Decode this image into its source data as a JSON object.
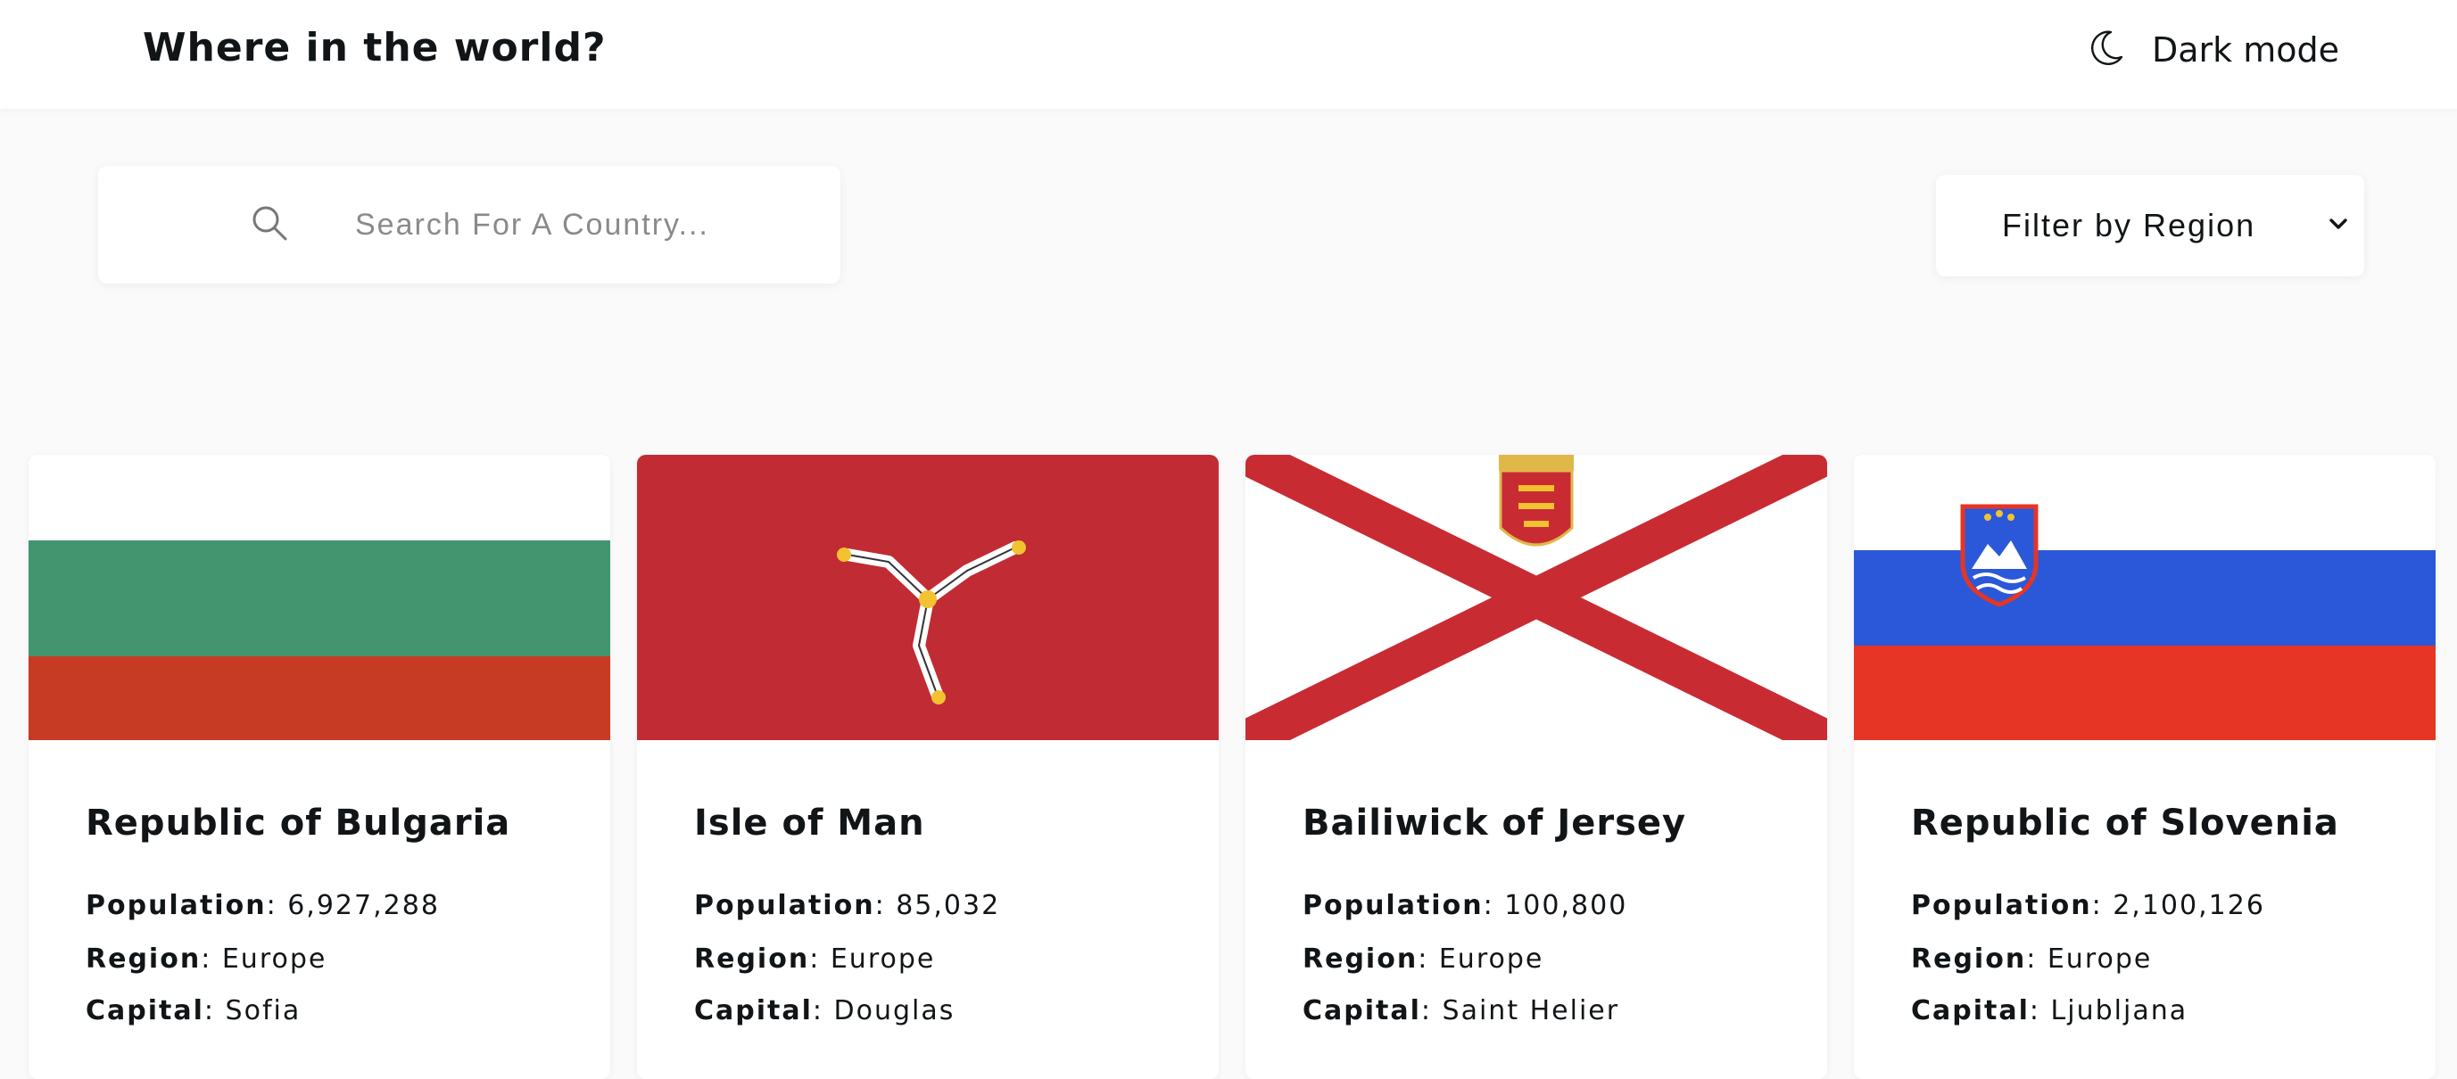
{
  "header": {
    "title": "Where in the world?",
    "theme_toggle_label": "Dark mode",
    "theme_icon": "moon-icon"
  },
  "search": {
    "placeholder": "Search For A Country...",
    "value": "",
    "icon": "search-icon"
  },
  "filter": {
    "selected": "Filter by Region",
    "icon": "chevron-down-icon"
  },
  "labels": {
    "population": "Population",
    "region": "Region",
    "capital": "Capital",
    "separator": ":"
  },
  "countries": [
    {
      "name": "Republic of Bulgaria",
      "population": "6,927,288",
      "region": "Europe",
      "capital": "Sofia",
      "flag_colors": [
        "#ffffff",
        "#42956e",
        "#c73b25"
      ]
    },
    {
      "name": "Isle of Man",
      "population": "85,032",
      "region": "Europe",
      "capital": "Douglas",
      "flag_colors": [
        "#c12b33",
        "#ffffff",
        "#f2c230"
      ]
    },
    {
      "name": "Bailiwick of Jersey",
      "population": "100,800",
      "region": "Europe",
      "capital": "Saint Helier",
      "flag_colors": [
        "#ffffff",
        "#c92b33",
        "#f2c230"
      ]
    },
    {
      "name": "Republic of Slovenia",
      "population": "2,100,126",
      "region": "Europe",
      "capital": "Ljubljana",
      "flag_colors": [
        "#ffffff",
        "#2b58d9",
        "#e63524"
      ]
    }
  ]
}
